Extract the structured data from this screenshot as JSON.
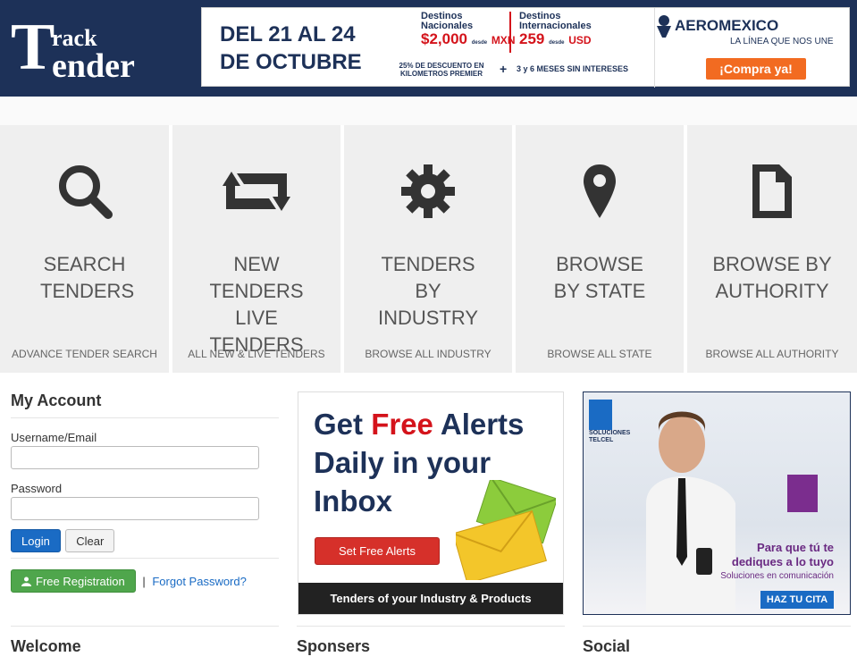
{
  "header": {
    "logo_t": "T",
    "logo_line1": "rack",
    "logo_line2": "ender"
  },
  "top_ad": {
    "dates": "DEL 21 AL 24 DE OCTUBRE",
    "domestic_label": "Destinos Nacionales",
    "domestic_desde": "desde",
    "domestic_price": "$2,000",
    "domestic_currency": "MXN",
    "intl_label": "Destinos Internacionales",
    "intl_desde": "desde",
    "intl_price": "259",
    "intl_currency": "USD",
    "discount": "25% DE DESCUENTO EN KILOMETROS PREMIER",
    "plus": "+",
    "msi": "3 y 6 MESES SIN INTERESES",
    "brand": "AEROMEXICO",
    "tagline": "LA LÍNEA QUE NOS UNE",
    "cta": "¡Compra ya!"
  },
  "tiles": [
    {
      "title": "SEARCH TENDERS",
      "subtitle": "ADVANCE TENDER SEARCH",
      "icon": "search-icon"
    },
    {
      "title": "NEW TENDERS LIVE TENDERS",
      "subtitle": "ALL NEW & LIVE TENDERS",
      "icon": "retweet-icon"
    },
    {
      "title": "TENDERS BY INDUSTRY",
      "subtitle": "BROWSE ALL INDUSTRY",
      "icon": "gear-icon"
    },
    {
      "title": "BROWSE BY STATE",
      "subtitle": "BROWSE ALL STATE",
      "icon": "map-pin-icon"
    },
    {
      "title": "BROWSE BY AUTHORITY",
      "subtitle": "BROWSE ALL AUTHORITY",
      "icon": "document-icon"
    }
  ],
  "account": {
    "title": "My Account",
    "username_label": "Username/Email",
    "username_value": "",
    "password_label": "Password",
    "password_value": "",
    "login_label": "Login",
    "clear_label": "Clear",
    "register_label": "Free Registration",
    "separator": "|",
    "forgot_label": "Forgot Password?"
  },
  "alerts": {
    "line1_a": "Get",
    "line1_free": "Free",
    "line1_b": "Alerts",
    "line2": "Daily in your",
    "line3": "Inbox",
    "button_label": "Set Free Alerts",
    "footer": "Tenders of your Industry & Products"
  },
  "side_ad": {
    "brand": "SOLUCIONES TELCEL",
    "line1": "Para que tú te dediques a lo tuyo",
    "line2": "Soluciones en comunicación",
    "cta": "HAZ TU CITA"
  },
  "sections": {
    "welcome": "Welcome",
    "sponsers": "Sponsers",
    "social": "Social"
  },
  "colors": {
    "header_bg": "#1d3158",
    "tile_bg": "#efefef",
    "login_blue": "#1a6bc4",
    "register_green": "#4fa64c",
    "alert_red": "#d6302a"
  }
}
